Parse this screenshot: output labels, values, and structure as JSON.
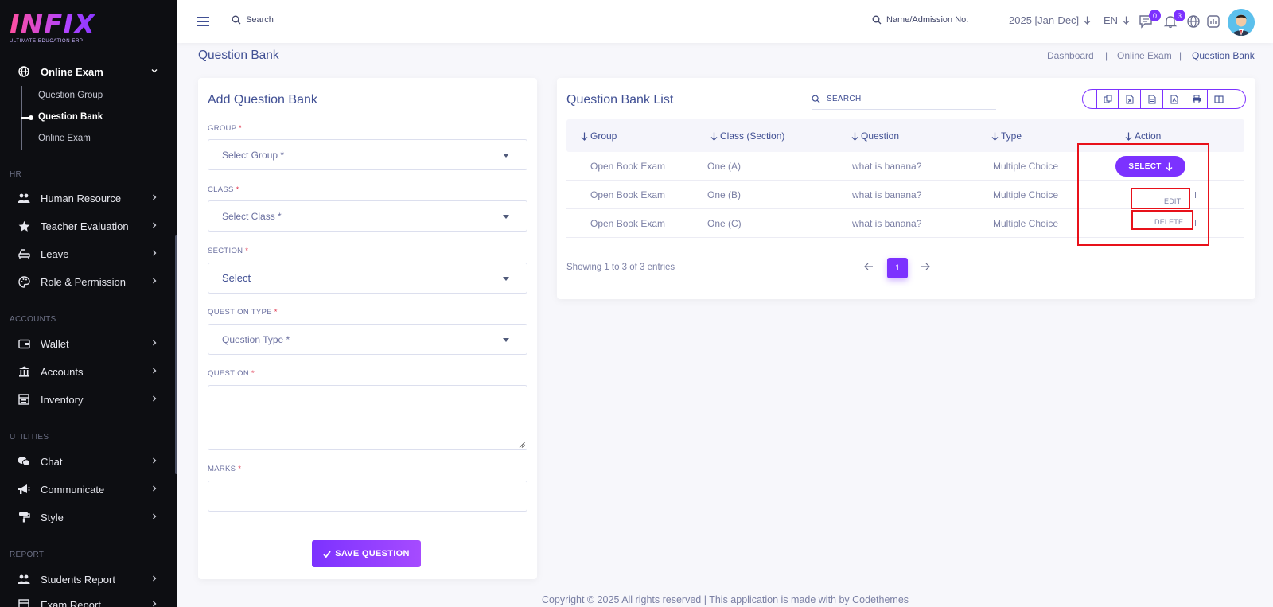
{
  "brand": {
    "logo_text": "INFIX",
    "logo_sub": "ULTIMATE EDUCATION ERP"
  },
  "sidebar": {
    "online_exam": {
      "label": "Online Exam",
      "children": [
        "Question Group",
        "Question Bank",
        "Online Exam"
      ]
    },
    "sections": {
      "hr": "HR",
      "accounts": "ACCOUNTS",
      "utilities": "UTILITIES",
      "report": "REPORT"
    },
    "hr_items": [
      "Human Resource",
      "Teacher Evaluation",
      "Leave",
      "Role & Permission"
    ],
    "accounts_items": [
      "Wallet",
      "Accounts",
      "Inventory"
    ],
    "utilities_items": [
      "Chat",
      "Communicate",
      "Style"
    ],
    "report_items": [
      "Students Report",
      "Exam Report"
    ]
  },
  "topbar": {
    "search_placeholder": "Search",
    "student_search_placeholder": "Name/Admission No.",
    "year": "2025 [Jan-Dec]",
    "language": "EN",
    "messages_count": "0",
    "notifications_count": "3"
  },
  "page": {
    "title": "Question Bank",
    "breadcrumb": [
      "Dashboard",
      "Online Exam",
      "Question Bank"
    ]
  },
  "form": {
    "title": "Add Question Bank",
    "group_label": "GROUP",
    "group_placeholder": "Select Group *",
    "class_label": "CLASS",
    "class_placeholder": "Select Class *",
    "section_label": "SECTION",
    "section_value": "Select",
    "qtype_label": "QUESTION TYPE",
    "qtype_placeholder": "Question Type *",
    "question_label": "QUESTION",
    "marks_label": "MARKS",
    "required_mark": "*",
    "save_label": "SAVE QUESTION"
  },
  "list": {
    "title": "Question Bank List",
    "search_placeholder": "SEARCH",
    "columns": [
      "Group",
      "Class (Section)",
      "Question",
      "Type",
      "Action"
    ],
    "rows": [
      {
        "group": "Open Book Exam",
        "class": "One (A)",
        "question": "what is banana?",
        "type": "Multiple Choice"
      },
      {
        "group": "Open Book Exam",
        "class": "One (B)",
        "question": "what is banana?",
        "type": "Multiple Choice"
      },
      {
        "group": "Open Book Exam",
        "class": "One (C)",
        "question": "what is banana?",
        "type": "Multiple Choice"
      }
    ],
    "select_label": "SELECT",
    "dropdown": {
      "edit": "EDIT",
      "delete": "DELETE"
    },
    "showing": "Showing 1 to 3 of 3 entries",
    "current_page": "1",
    "export_icons": [
      "copy-icon",
      "excel-icon",
      "csv-icon",
      "pdf-icon",
      "print-icon",
      "columns-icon"
    ]
  },
  "footer": {
    "text": "Copyright © 2025 All rights reserved | This application is made with by Codethemes"
  },
  "colors": {
    "accent": "#7c32ff",
    "text": "#415094",
    "sidebar_bg": "#0d0e12",
    "highlight": "#e8111a"
  }
}
